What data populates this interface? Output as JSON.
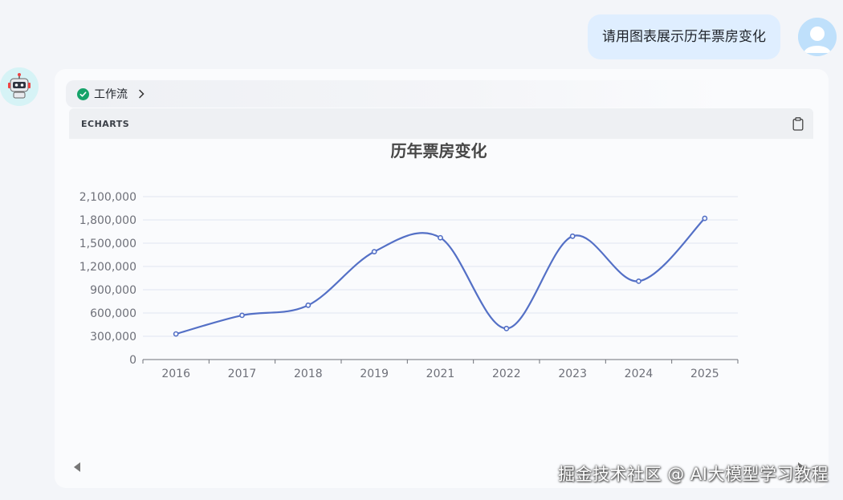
{
  "user_message": {
    "text": "请用图表展示历年票房变化"
  },
  "workflow": {
    "label": "工作流",
    "status_color": "#16a36a"
  },
  "code_block": {
    "language": "ECHARTS"
  },
  "chart_data": {
    "type": "line",
    "title": "历年票房变化",
    "categories": [
      "2016",
      "2017",
      "2018",
      "2019",
      "2021",
      "2022",
      "2023",
      "2024",
      "2025"
    ],
    "values": [
      330000,
      570000,
      700000,
      1390000,
      1570000,
      400000,
      1590000,
      1010000,
      1820000
    ],
    "ylim": [
      0,
      2100000
    ],
    "yticks": [
      0,
      300000,
      600000,
      900000,
      1200000,
      1500000,
      1800000,
      2100000
    ],
    "ytick_labels": [
      "0",
      "300,000",
      "600,000",
      "900,000",
      "1,200,000",
      "1,500,000",
      "1,800,000",
      "2,100,000"
    ],
    "smooth": true,
    "grid": true,
    "line_color": "#5470c6"
  },
  "watermark": {
    "text": "掘金技术社区 @ AI大模型学习教程"
  }
}
